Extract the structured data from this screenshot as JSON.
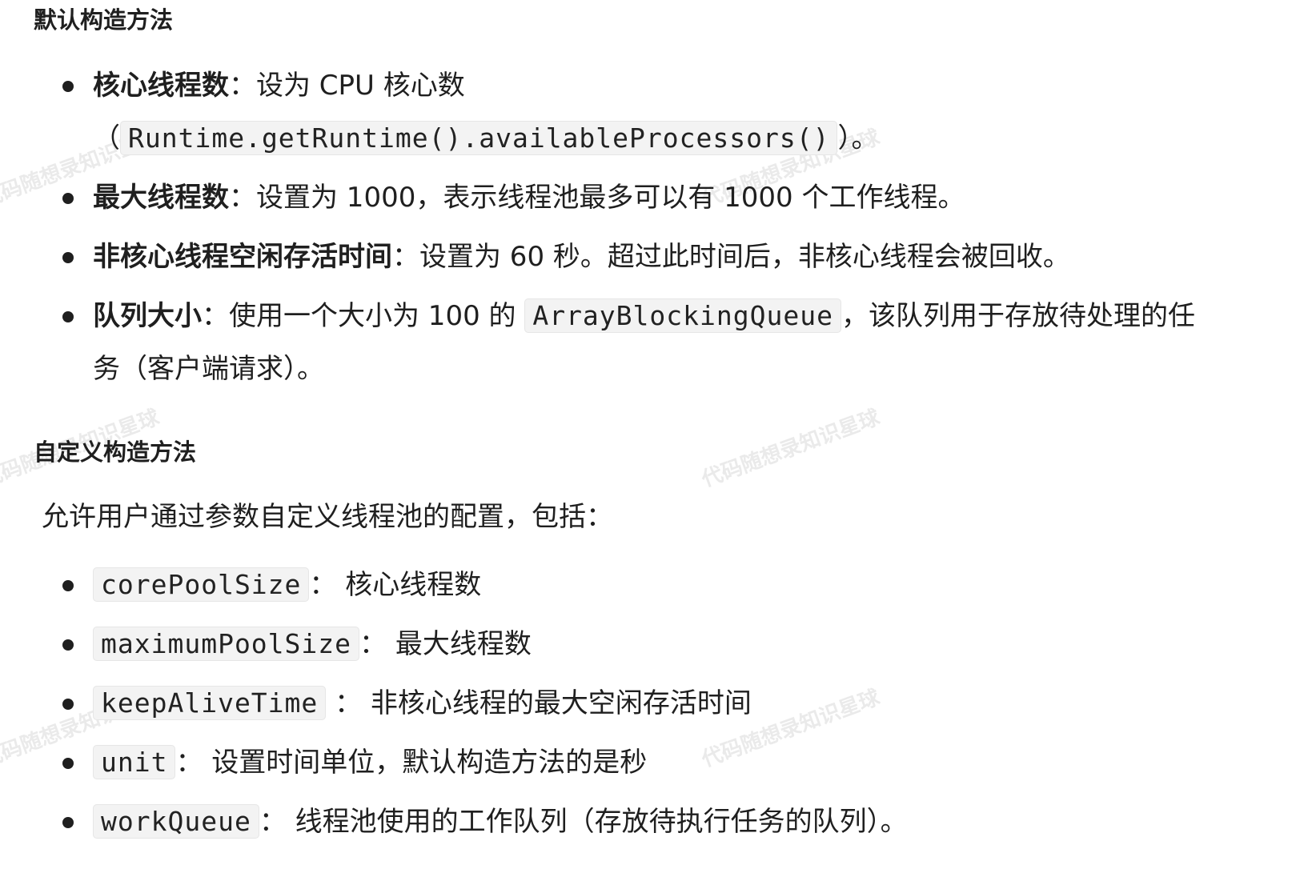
{
  "section1": {
    "heading": "默认构造方法",
    "items": [
      {
        "bold": "核心线程数",
        "sep": "：",
        "text": "设为 CPU 核心数（",
        "code": "Runtime.getRuntime().availableProcessors()",
        "after": "）。"
      },
      {
        "bold": "最大线程数",
        "sep": "：",
        "text": "设置为 1000，表示线程池最多可以有 1000 个工作线程。"
      },
      {
        "bold": "非核心线程空闲存活时间",
        "sep": "：",
        "text": "设置为 60 秒。超过此时间后，非核心线程会被回收。"
      },
      {
        "bold": "队列大小",
        "sep": "：",
        "text": "使用一个大小为 100 的 ",
        "code": "ArrayBlockingQueue",
        "after": "，该队列用于存放待处理的任务（客户端请求）。"
      }
    ]
  },
  "section2": {
    "heading": "自定义构造方法",
    "intro": "允许用户通过参数自定义线程池的配置，包括：",
    "items": [
      {
        "code": "corePoolSize",
        "text": "： 核心线程数"
      },
      {
        "code": "maximumPoolSize",
        "text": "： 最大线程数"
      },
      {
        "code": "keepAliveTime",
        "text": " ： 非核心线程的最大空闲存活时间"
      },
      {
        "code": "unit",
        "text": "： 设置时间单位，默认构造方法的是秒"
      },
      {
        "code": "workQueue",
        "text": "： 线程池使用的工作队列（存放待执行任务的队列）。"
      }
    ]
  },
  "watermark": "代码随想录知识星球"
}
